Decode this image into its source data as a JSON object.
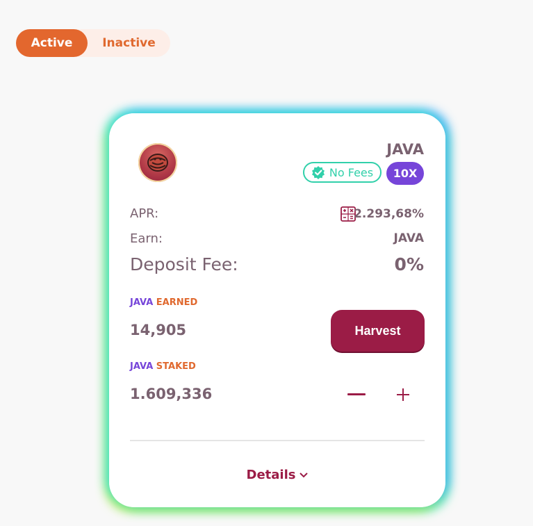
{
  "toggle": {
    "active_label": "Active",
    "inactive_label": "Inactive"
  },
  "farm": {
    "token_name": "JAVA",
    "no_fees_label": "No Fees",
    "multiplier": "10X",
    "apr_label": "APR:",
    "apr_value": "2.293,68%",
    "earn_label": "Earn:",
    "earn_value": "JAVA",
    "deposit_fee_label": "Deposit Fee:",
    "deposit_fee_value": "0%",
    "earned_token": "JAVA",
    "earned_label": "EARNED",
    "earned_amount": "14,905",
    "harvest_label": "Harvest",
    "staked_token": "JAVA",
    "staked_label": "STAKED",
    "staked_amount": "1.609,336",
    "details_label": "Details"
  },
  "colors": {
    "accent_orange": "#e3672e",
    "primary_maroon": "#9b1c46",
    "purple": "#7645d9",
    "teal": "#31d0aa",
    "text": "#7a6270"
  },
  "icons": [
    "verified-check-icon",
    "calculator-icon",
    "minus-icon",
    "plus-icon",
    "chevron-down-icon"
  ]
}
